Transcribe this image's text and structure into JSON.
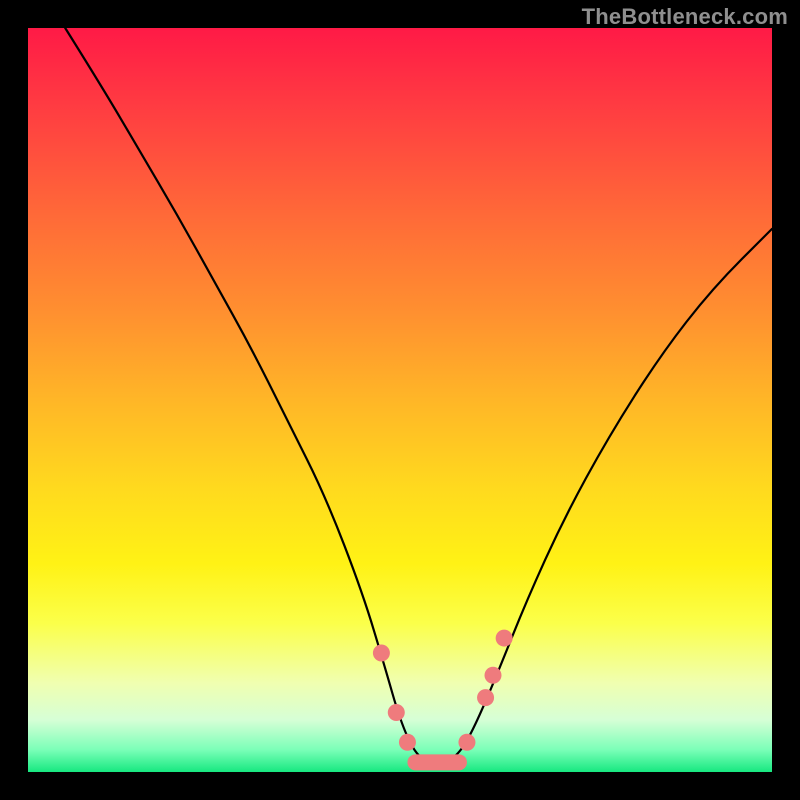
{
  "watermark": "TheBottleneck.com",
  "colors": {
    "background": "#000000",
    "gradient_top": "#ff1a46",
    "gradient_bottom": "#17e880",
    "curve": "#000000",
    "markers": "#ef7b7d"
  },
  "chart_data": {
    "type": "line",
    "title": "",
    "xlabel": "",
    "ylabel": "",
    "xlim": [
      0,
      100
    ],
    "ylim": [
      0,
      100
    ],
    "series": [
      {
        "name": "bottleneck-curve",
        "x": [
          5,
          10,
          15,
          20,
          25,
          30,
          35,
          40,
          45,
          48,
          50,
          52,
          54,
          56,
          58,
          60,
          63,
          67,
          72,
          78,
          85,
          92,
          100
        ],
        "y": [
          100,
          92,
          83.5,
          75,
          66,
          57,
          47,
          37,
          24,
          14,
          7,
          2.5,
          1.2,
          1.2,
          2.5,
          6,
          13,
          23,
          34,
          45,
          56,
          65,
          73
        ]
      }
    ],
    "markers": [
      {
        "x": 47.5,
        "y": 16
      },
      {
        "x": 49.5,
        "y": 8
      },
      {
        "x": 51,
        "y": 4
      },
      {
        "x": 59,
        "y": 4
      },
      {
        "x": 61.5,
        "y": 10
      },
      {
        "x": 62.5,
        "y": 13
      },
      {
        "x": 64,
        "y": 18
      }
    ],
    "marker_bar": {
      "x0": 51,
      "x1": 59,
      "y": 1.3
    }
  }
}
